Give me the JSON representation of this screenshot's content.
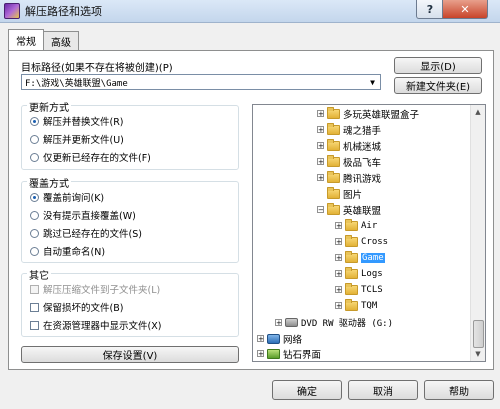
{
  "window": {
    "title": "解压路径和选项",
    "help_label": "?",
    "close_label": "✕"
  },
  "tabs": [
    "常规",
    "高级"
  ],
  "target": {
    "label": "目标路径(如果不存在将被创建)(P)",
    "value": "F:\\游戏\\英雄联盟\\Game",
    "show_button": "显示(D)",
    "new_folder_button": "新建文件夹(E)"
  },
  "update_mode": {
    "title": "更新方式",
    "options": [
      {
        "label": "解压并替换文件(R)",
        "selected": true
      },
      {
        "label": "解压并更新文件(U)",
        "selected": false
      },
      {
        "label": "仅更新已经存在的文件(F)",
        "selected": false
      }
    ]
  },
  "overwrite_mode": {
    "title": "覆盖方式",
    "options": [
      {
        "label": "覆盖前询问(K)",
        "selected": true
      },
      {
        "label": "没有提示直接覆盖(W)",
        "selected": false
      },
      {
        "label": "跳过已经存在的文件(S)",
        "selected": false
      },
      {
        "label": "自动重命名(N)",
        "selected": false
      }
    ]
  },
  "misc": {
    "title": "其它",
    "options": [
      {
        "label": "解压压缩文件到子文件夹(L)",
        "checked": false,
        "disabled": true
      },
      {
        "label": "保留损坏的文件(B)",
        "checked": false,
        "disabled": false
      },
      {
        "label": "在资源管理器中显示文件(X)",
        "checked": false,
        "disabled": false
      }
    ]
  },
  "save_settings_button": "保存设置(V)",
  "tree": [
    {
      "label": "多玩英雄联盟盒子",
      "icon": "folder-icon",
      "expander": "+"
    },
    {
      "label": "魂之猎手",
      "icon": "folder-icon",
      "expander": "+"
    },
    {
      "label": "机械迷城",
      "icon": "folder-icon",
      "expander": "+"
    },
    {
      "label": "极品飞车",
      "icon": "folder-icon",
      "expander": "+"
    },
    {
      "label": "腾讯游戏",
      "icon": "folder-icon",
      "expander": "+"
    },
    {
      "label": "图片",
      "icon": "folder-icon",
      "expander": ""
    },
    {
      "label": "英雄联盟",
      "icon": "folder-icon",
      "expander": "−"
    },
    {
      "label": "Air",
      "icon": "folder-icon",
      "expander": "+"
    },
    {
      "label": "Cross",
      "icon": "folder-icon",
      "expander": "+"
    },
    {
      "label": "Game",
      "icon": "folder-icon",
      "expander": "+",
      "selected": true
    },
    {
      "label": "Logs",
      "icon": "folder-icon",
      "expander": "+"
    },
    {
      "label": "TCLS",
      "icon": "folder-icon",
      "expander": "+"
    },
    {
      "label": "TQM",
      "icon": "folder-icon",
      "expander": "+"
    },
    {
      "label": "DVD RW 驱动器 (G:)",
      "icon": "dvd-drive-icon",
      "expander": "+"
    },
    {
      "label": "网络",
      "icon": "network-icon",
      "expander": "+"
    },
    {
      "label": "钻石界面",
      "icon": "folder-icon",
      "expander": "+"
    }
  ],
  "footer": {
    "ok": "确定",
    "cancel": "取消",
    "help": "帮助"
  },
  "colors": {
    "selection": "#3399ff",
    "close_button": "#c8442a",
    "titlebar": "#c3d6ec"
  }
}
